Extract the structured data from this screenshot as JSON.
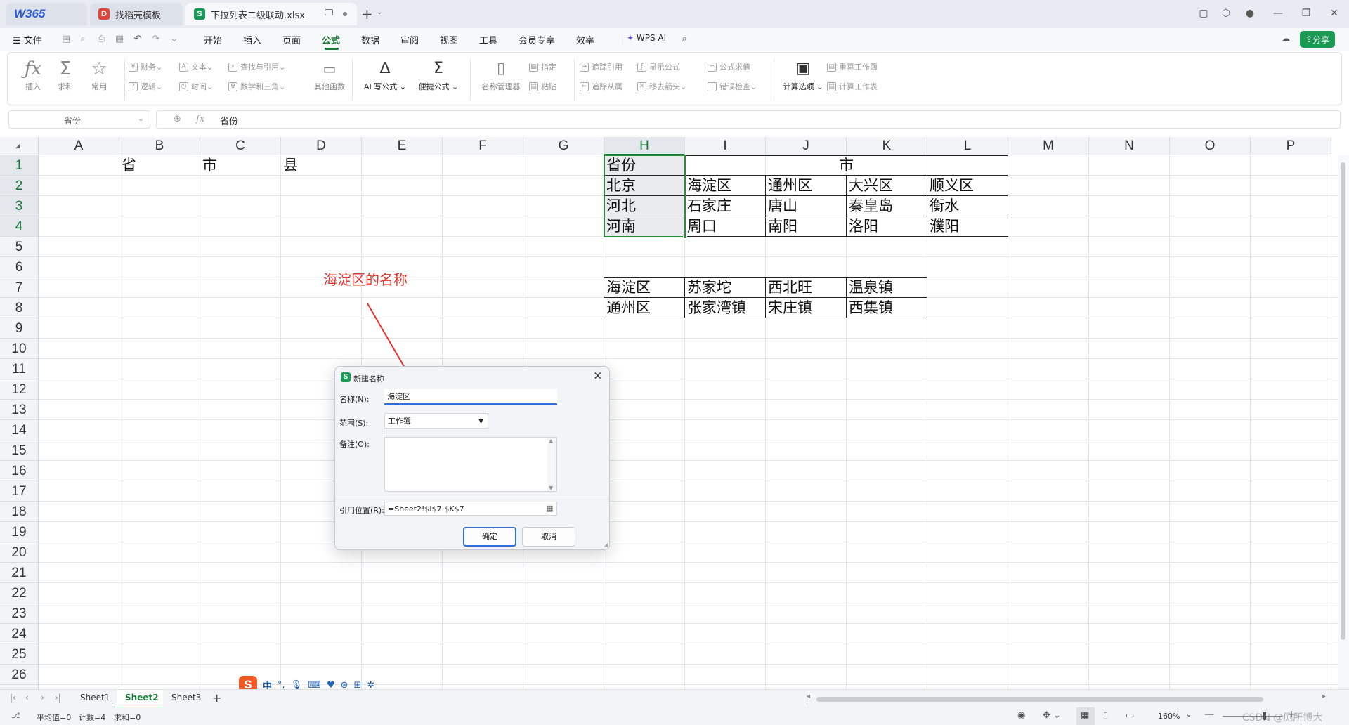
{
  "titlebar": {
    "tabs": [
      {
        "label": "W365",
        "kind": "home"
      },
      {
        "label": "找稻壳模板",
        "kind": "template"
      },
      {
        "label": "下拉列表二级联动.xlsx",
        "kind": "document"
      }
    ],
    "new_tab_label": "+"
  },
  "menubar": {
    "file_label": "文件",
    "items": [
      "开始",
      "插入",
      "页面",
      "公式",
      "数据",
      "审阅",
      "视图",
      "工具",
      "会员专享",
      "效率"
    ],
    "active_item": "公式",
    "wps_ai_label": "WPS AI",
    "share_label": "分享"
  },
  "ribbon": {
    "big_buttons": [
      {
        "label": "插入",
        "icon": "fx-icon"
      },
      {
        "label": "求和",
        "icon": "sigma-icon"
      },
      {
        "label": "常用",
        "icon": "star-icon"
      }
    ],
    "func_groups": [
      {
        "label": "财务"
      },
      {
        "label": "文本"
      },
      {
        "label": "查找与引用"
      },
      {
        "label": "逻辑"
      },
      {
        "label": "时间"
      },
      {
        "label": "数学和三角"
      }
    ],
    "other_func_label": "其他函数",
    "ai_formula_label": "AI 写公式",
    "quick_formula_label": "便捷公式",
    "name_manager_label": "名称管理器",
    "specify_label": "指定",
    "paste_label": "粘贴",
    "audit": [
      {
        "label": "追踪引用"
      },
      {
        "label": "显示公式"
      },
      {
        "label": "公式求值"
      },
      {
        "label": "追踪从属"
      },
      {
        "label": "移去箭头"
      },
      {
        "label": "错误检查"
      }
    ],
    "calc_options_label": "计算选项",
    "recalc_workbook_label": "重算工作簿",
    "calc_sheet_label": "计算工作表"
  },
  "formula_bar": {
    "name_box": "省份",
    "fx_label": "fx",
    "content": "省份"
  },
  "grid": {
    "columns": [
      "A",
      "B",
      "C",
      "D",
      "E",
      "F",
      "G",
      "H",
      "I",
      "J",
      "K",
      "L",
      "M",
      "N",
      "O",
      "P"
    ],
    "selected_column": "H",
    "rows": [
      "1",
      "2",
      "3",
      "4",
      "5",
      "6",
      "7",
      "8",
      "9",
      "10",
      "11",
      "12",
      "13",
      "14",
      "15",
      "16",
      "17",
      "18",
      "19",
      "20",
      "21",
      "22",
      "23",
      "24",
      "25",
      "26"
    ],
    "header_cells": {
      "B1": "省",
      "C1": "市",
      "D1": "县"
    },
    "province_table": {
      "title_province": "省份",
      "title_city": "市",
      "rows": [
        {
          "province": "北京",
          "cities": [
            "海淀区",
            "通州区",
            "大兴区",
            "顺义区"
          ]
        },
        {
          "province": "河北",
          "cities": [
            "石家庄",
            "唐山",
            "秦皇岛",
            "衡水"
          ]
        },
        {
          "province": "河南",
          "cities": [
            "周口",
            "南阳",
            "洛阳",
            "濮阳"
          ]
        }
      ]
    },
    "county_table": {
      "rows": [
        [
          "海淀区",
          "苏家坨",
          "西北旺",
          "温泉镇"
        ],
        [
          "通州区",
          "张家湾镇",
          "宋庄镇",
          "西集镇"
        ]
      ]
    }
  },
  "annotation": {
    "text": "海淀区的名称",
    "color": "#e8342c"
  },
  "dialog": {
    "title": "新建名称",
    "name_label": "名称(N):",
    "name_value": "海淀区",
    "scope_label": "范围(S):",
    "scope_value": "工作簿",
    "comment_label": "备注(O):",
    "comment_value": "",
    "ref_label": "引用位置(R):",
    "ref_value": "=Sheet2!$I$7:$K$7",
    "ok_label": "确定",
    "cancel_label": "取消"
  },
  "sheets": {
    "tabs": [
      "Sheet1",
      "Sheet2",
      "Sheet3"
    ],
    "active": "Sheet2",
    "add_label": "+"
  },
  "ime": {
    "lang_label": "中"
  },
  "status": {
    "average": "平均值=0",
    "count": "计数=4",
    "sum": "求和=0",
    "zoom": "160%",
    "watermark": "CSDN @厕所博大"
  },
  "colors": {
    "accent": "#1a7a3a",
    "share_bg": "#1a9a55",
    "dialog_primary_border": "#2f6fdc"
  }
}
